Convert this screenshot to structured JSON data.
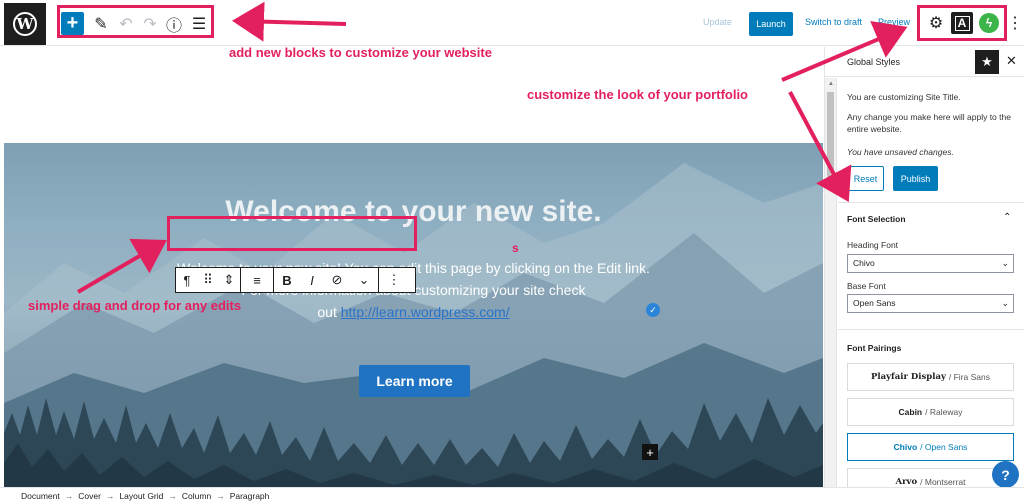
{
  "topbar": {
    "logo_glyph": "W",
    "tools": {
      "add_glyph": "+",
      "edit_glyph": "✎",
      "undo_glyph": "↶",
      "redo_glyph": "↷",
      "info_glyph": "ⓘ",
      "outline_glyph": "☰"
    },
    "update_label": "Update",
    "launch_label": "Launch",
    "switch_draft_label": "Switch to draft",
    "preview_label": "Preview",
    "settings_glyph": "⚙",
    "a_glyph": "A",
    "jetpack_glyph": "ϟ",
    "more_glyph": "⋮"
  },
  "cover": {
    "title": "Welcome to your new site.",
    "line1": "Welcome to your new site! You can edit this page by clicking on the Edit link.",
    "line2": "For more information about customizing your site check",
    "line3_prefix": "out ",
    "link": "http://learn.wordpress.com/",
    "button": "Learn more",
    "stray_s": "s",
    "check_glyph": "✓",
    "plus_glyph": "+"
  },
  "block_toolbar": {
    "paragraph": "¶",
    "drag": "⠿",
    "mover": "⇕",
    "align": "≡",
    "bold": "B",
    "italic": "I",
    "link": "⊘",
    "more_caret": "⌄",
    "options": "⋮"
  },
  "sidebar": {
    "title": "Global Styles",
    "star_glyph": "★",
    "close_glyph": "✕",
    "scroll_up": "▲",
    "info1": "You are customizing Site Title.",
    "info2": "Any change you make here will apply to the entire website.",
    "unsaved": "You have unsaved changes.",
    "reset_label": "Reset",
    "publish_label": "Publish",
    "font_selection": "Font Selection",
    "chevron": "⌃",
    "heading_font_label": "Heading Font",
    "heading_font_value": "Chivo",
    "base_font_label": "Base Font",
    "base_font_value": "Open Sans",
    "select_caret": "⌄",
    "font_pairings": "Font Pairings",
    "pairings": [
      {
        "heading": "Playfair Display",
        "base": "/ Fira Sans"
      },
      {
        "heading": "Cabin",
        "base": "/ Raleway"
      },
      {
        "heading": "Chivo",
        "base": "/ Open Sans"
      },
      {
        "heading": "Arvo",
        "base": "/ Montserrat"
      }
    ],
    "help_glyph": "?"
  },
  "footer": {
    "crumbs": [
      "Document",
      "Cover",
      "Layout Grid",
      "Column",
      "Paragraph"
    ],
    "separator": "→"
  },
  "annotations": {
    "top": "add new blocks to customize your website",
    "right": "customize the look of your portfolio",
    "left": "simple drag and drop for any edits",
    "color": "#e3205e"
  },
  "colors": {
    "accent": "#007cba",
    "dark": "#1e1e1e",
    "jetpack": "#3bb54a"
  }
}
